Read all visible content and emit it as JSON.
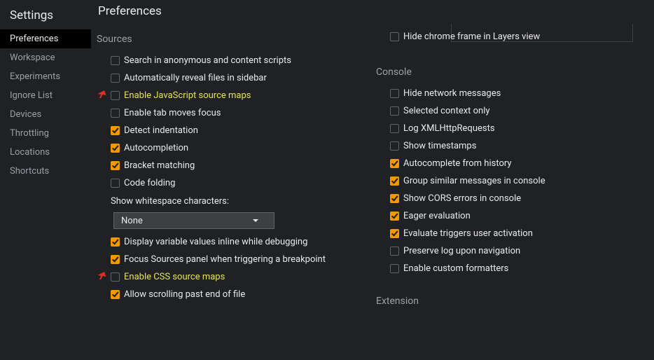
{
  "sidebar": {
    "title": "Settings",
    "items": [
      {
        "label": "Preferences",
        "selected": true
      },
      {
        "label": "Workspace",
        "selected": false
      },
      {
        "label": "Experiments",
        "selected": false
      },
      {
        "label": "Ignore List",
        "selected": false
      },
      {
        "label": "Devices",
        "selected": false
      },
      {
        "label": "Throttling",
        "selected": false
      },
      {
        "label": "Locations",
        "selected": false
      },
      {
        "label": "Shortcuts",
        "selected": false
      }
    ]
  },
  "main": {
    "title": "Preferences"
  },
  "left_column": {
    "sections": [
      {
        "title": "Sources",
        "items": [
          {
            "label": "Search in anonymous and content scripts",
            "checked": false,
            "hl": false,
            "mark": false
          },
          {
            "label": "Automatically reveal files in sidebar",
            "checked": false,
            "hl": false,
            "mark": false
          },
          {
            "label": "Enable JavaScript source maps",
            "checked": false,
            "hl": true,
            "mark": true
          },
          {
            "label": "Enable tab moves focus",
            "checked": false,
            "hl": false,
            "mark": false
          },
          {
            "label": "Detect indentation",
            "checked": true,
            "hl": false,
            "mark": false
          },
          {
            "label": "Autocompletion",
            "checked": true,
            "hl": false,
            "mark": false
          },
          {
            "label": "Bracket matching",
            "checked": true,
            "hl": false,
            "mark": false
          },
          {
            "label": "Code folding",
            "checked": false,
            "hl": false,
            "mark": false
          }
        ],
        "whitespace": {
          "label": "Show whitespace characters:",
          "value": "None"
        },
        "items2": [
          {
            "label": "Display variable values inline while debugging",
            "checked": true,
            "hl": false,
            "mark": false
          },
          {
            "label": "Focus Sources panel when triggering a breakpoint",
            "checked": true,
            "hl": false,
            "mark": false
          },
          {
            "label": "Enable CSS source maps",
            "checked": false,
            "hl": true,
            "mark": true
          },
          {
            "label": "Allow scrolling past end of file",
            "checked": true,
            "hl": false,
            "mark": false
          }
        ]
      }
    ]
  },
  "right_column": {
    "top_item": {
      "label": "Hide chrome frame in Layers view",
      "checked": false
    },
    "sections": [
      {
        "title": "Console",
        "items": [
          {
            "label": "Hide network messages",
            "checked": false
          },
          {
            "label": "Selected context only",
            "checked": false
          },
          {
            "label": "Log XMLHttpRequests",
            "checked": false
          },
          {
            "label": "Show timestamps",
            "checked": false
          },
          {
            "label": "Autocomplete from history",
            "checked": true
          },
          {
            "label": "Group similar messages in console",
            "checked": true
          },
          {
            "label": "Show CORS errors in console",
            "checked": true
          },
          {
            "label": "Eager evaluation",
            "checked": true
          },
          {
            "label": "Evaluate triggers user activation",
            "checked": true
          },
          {
            "label": "Preserve log upon navigation",
            "checked": false
          },
          {
            "label": "Enable custom formatters",
            "checked": false
          }
        ]
      },
      {
        "title": "Extension",
        "items": []
      }
    ]
  }
}
